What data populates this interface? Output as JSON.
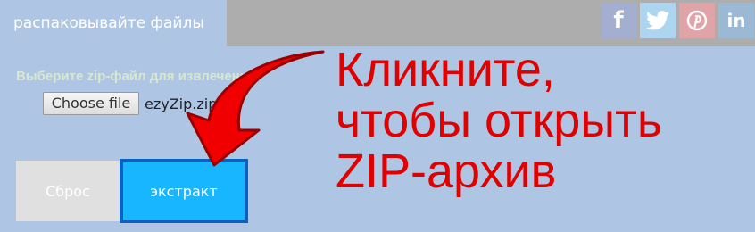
{
  "tab": {
    "label": "распаковывайте файлы"
  },
  "social": [
    {
      "icon": "facebook-icon",
      "glyph": "f",
      "color": "#a3aed0"
    },
    {
      "icon": "twitter-icon",
      "color": "#aed5ef"
    },
    {
      "icon": "pinterest-icon",
      "color": "#e0a3a8"
    },
    {
      "icon": "linkedin-icon",
      "glyph": "in",
      "color": "#9bb9d4"
    }
  ],
  "form": {
    "select_label": "Выберите zip-файл для извлечения",
    "file_button": "Choose file",
    "file_name": "ezyZip.zip",
    "reset_button": "Сброс",
    "extract_button": "экстракт"
  },
  "callout": {
    "lines": [
      "Кликните,",
      "чтобы открыть",
      "ZIP-архив"
    ],
    "color": "#e00000"
  }
}
